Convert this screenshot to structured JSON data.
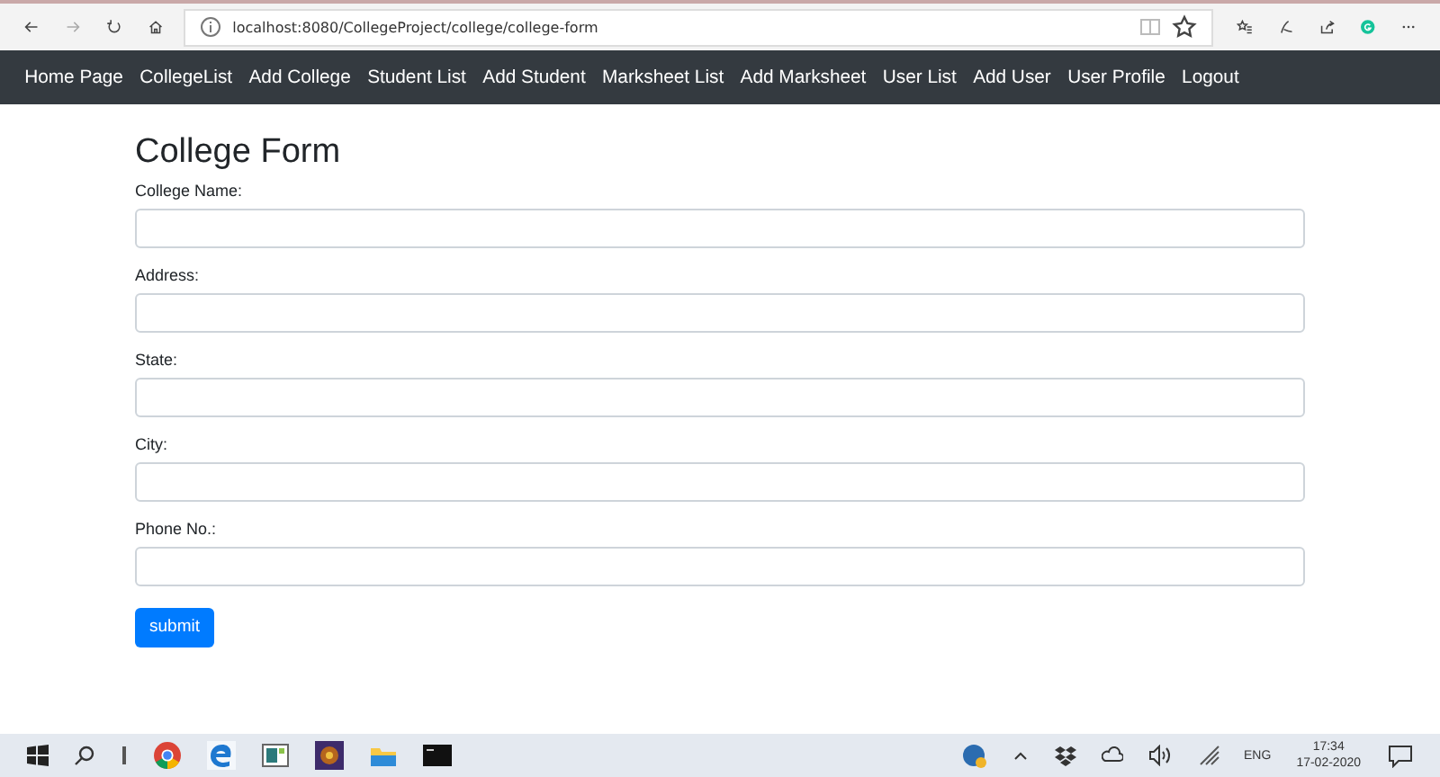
{
  "browser": {
    "url": "localhost:8080/CollegeProject/college/college-form"
  },
  "nav": [
    "Home Page",
    "CollegeList",
    "Add College",
    "Student List",
    "Add Student",
    "Marksheet List",
    "Add Marksheet",
    "User List",
    "Add User",
    "User Profile",
    "Logout"
  ],
  "form": {
    "title": "College Form",
    "fields": [
      {
        "label": "College Name:"
      },
      {
        "label": "Address:"
      },
      {
        "label": "State:"
      },
      {
        "label": "City:"
      },
      {
        "label": "Phone No.:"
      }
    ],
    "submit": "submit"
  },
  "taskbar": {
    "language": "ENG",
    "time": "17:34",
    "date": "17-02-2020"
  }
}
